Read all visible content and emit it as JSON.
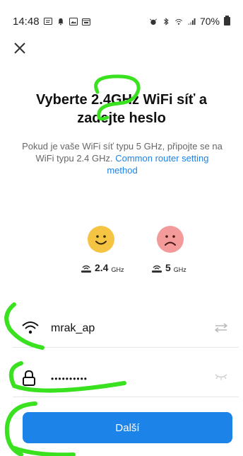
{
  "status_bar": {
    "time": "14:48",
    "battery": "70%"
  },
  "header": {
    "title_line1": "Vyberte 2.4GHz WiFi síť a",
    "title_line2": "zadejte heslo"
  },
  "info": {
    "text": "Pokud je vaše WiFi síť typu 5 GHz, připojte se na WiFi typu 2.4 GHz. ",
    "link": "Common router setting method"
  },
  "bands": {
    "good": {
      "main": "2.4",
      "unit": "GHz"
    },
    "bad": {
      "main": "5",
      "unit": "GHz"
    }
  },
  "form": {
    "ssid": "mrak_ap",
    "password_masked": "••••••••••"
  },
  "actions": {
    "next_label": "Další"
  },
  "colors": {
    "accent": "#1c83e8",
    "happy_face": "#f5c443",
    "sad_face": "#f39a9b",
    "annotation": "#39e11f"
  }
}
